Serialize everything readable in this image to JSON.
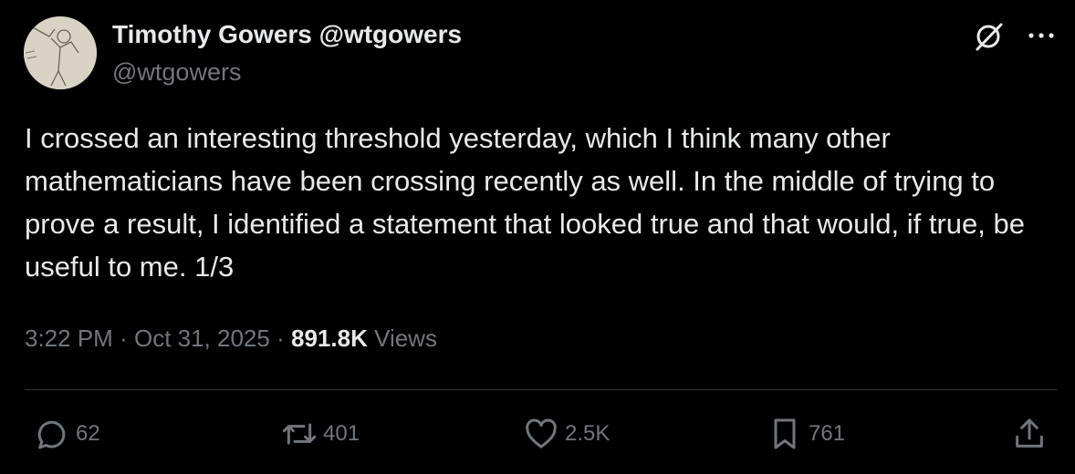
{
  "author": {
    "display_name": "Timothy Gowers @wtgowers",
    "handle": "@wtgowers",
    "avatar_icon": "sketch-portrait-avatar"
  },
  "header_icons": [
    "grok-icon",
    "more-icon"
  ],
  "tweet": {
    "text": "I crossed an interesting threshold yesterday, which I think many other mathematicians have been crossing recently as well. In the middle of trying to prove a result, I identified a statement that looked true and that would, if true, be useful to me. 1/3"
  },
  "meta": {
    "time": "3:22 PM",
    "date": "Oct 31, 2025",
    "separator": "·",
    "views_count": "891.8K",
    "views_label": "Views"
  },
  "actions": {
    "reply_count": "62",
    "repost_count": "401",
    "like_count": "2.5K",
    "bookmark_count": "761"
  },
  "colors": {
    "background": "#000000",
    "text": "#e7e9ea",
    "secondary": "#71767b",
    "divider": "#2f3336"
  }
}
